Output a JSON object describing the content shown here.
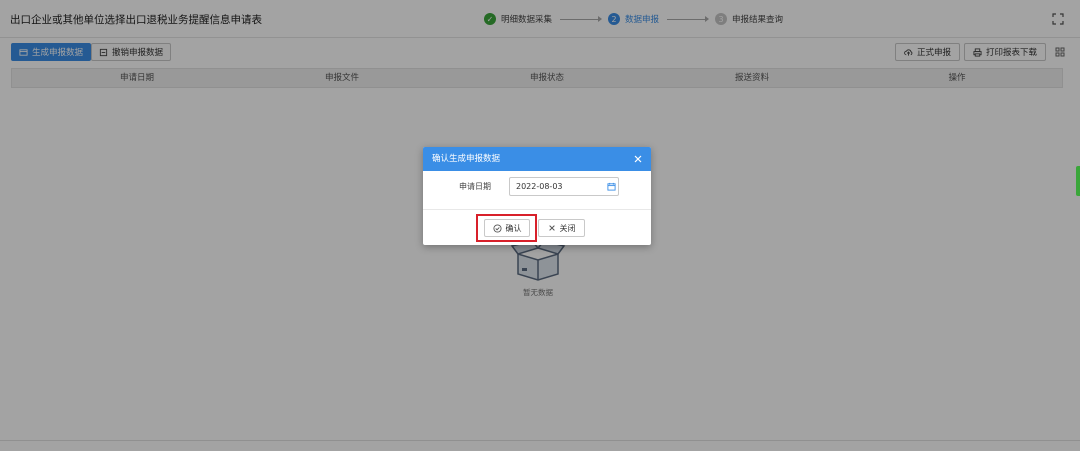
{
  "header": {
    "title": "出口企业或其他单位选择出口退税业务提醒信息申请表",
    "steps": [
      {
        "label": "明细数据采集",
        "state": "done",
        "marker": "✓"
      },
      {
        "label": "数据申报",
        "state": "active",
        "marker": "2"
      },
      {
        "label": "申报结果查询",
        "state": "todo",
        "marker": "3"
      }
    ]
  },
  "toolbar": {
    "generate_label": "生成申报数据",
    "revoke_label": "撤销申报数据",
    "formal_declare_label": "正式申报",
    "print_download_label": "打印报表下载"
  },
  "table": {
    "columns": [
      "申请日期",
      "申报文件",
      "申报状态",
      "报送资料",
      "操作"
    ]
  },
  "empty": {
    "label": "暂无数据"
  },
  "dialog": {
    "title": "确认生成申报数据",
    "date_label": "申请日期",
    "date_value": "2022-08-03",
    "confirm_label": "确认",
    "close_label": "关闭"
  },
  "colors": {
    "primary": "#3a8ee6",
    "done_green": "#3aa63a",
    "highlight_red": "#d8202a"
  }
}
